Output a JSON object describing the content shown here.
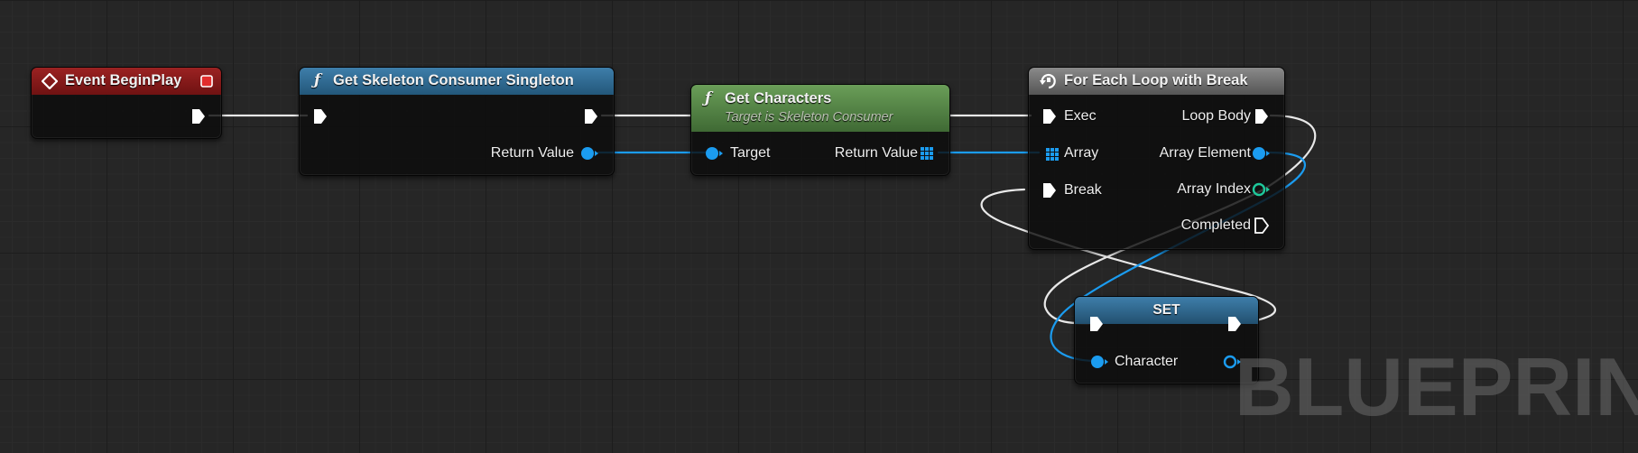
{
  "graph": {
    "nodes": {
      "event_begin_play": {
        "title": "Event BeginPlay",
        "header_color": "#8c1c1c"
      },
      "get_skeleton_consumer_singleton": {
        "title": "Get Skeleton Consumer Singleton",
        "header_color": "#2f6f96",
        "function_icon": "ƒ",
        "pins": {
          "return_value": "Return Value"
        }
      },
      "get_characters": {
        "title": "Get Characters",
        "subtitle": "Target is Skeleton Consumer",
        "header_color": "#5b8a4c",
        "function_icon": "ƒ",
        "pins": {
          "target": "Target",
          "return_value": "Return Value"
        }
      },
      "for_each_loop_with_break": {
        "title": "For Each Loop with Break",
        "header_color": "#6e6e6e",
        "pins": {
          "exec": "Exec",
          "array": "Array",
          "break": "Break",
          "loop_body": "Loop Body",
          "array_element": "Array Element",
          "array_index": "Array Index",
          "completed": "Completed"
        }
      },
      "set": {
        "title": "SET",
        "header_color": "#2f6f96",
        "pins": {
          "character": "Character"
        }
      }
    },
    "pin_colors": {
      "exec": "#ffffff",
      "object": "#1b9cf0",
      "integer": "#1ec89b"
    }
  },
  "watermark": "BLUEPRINT"
}
